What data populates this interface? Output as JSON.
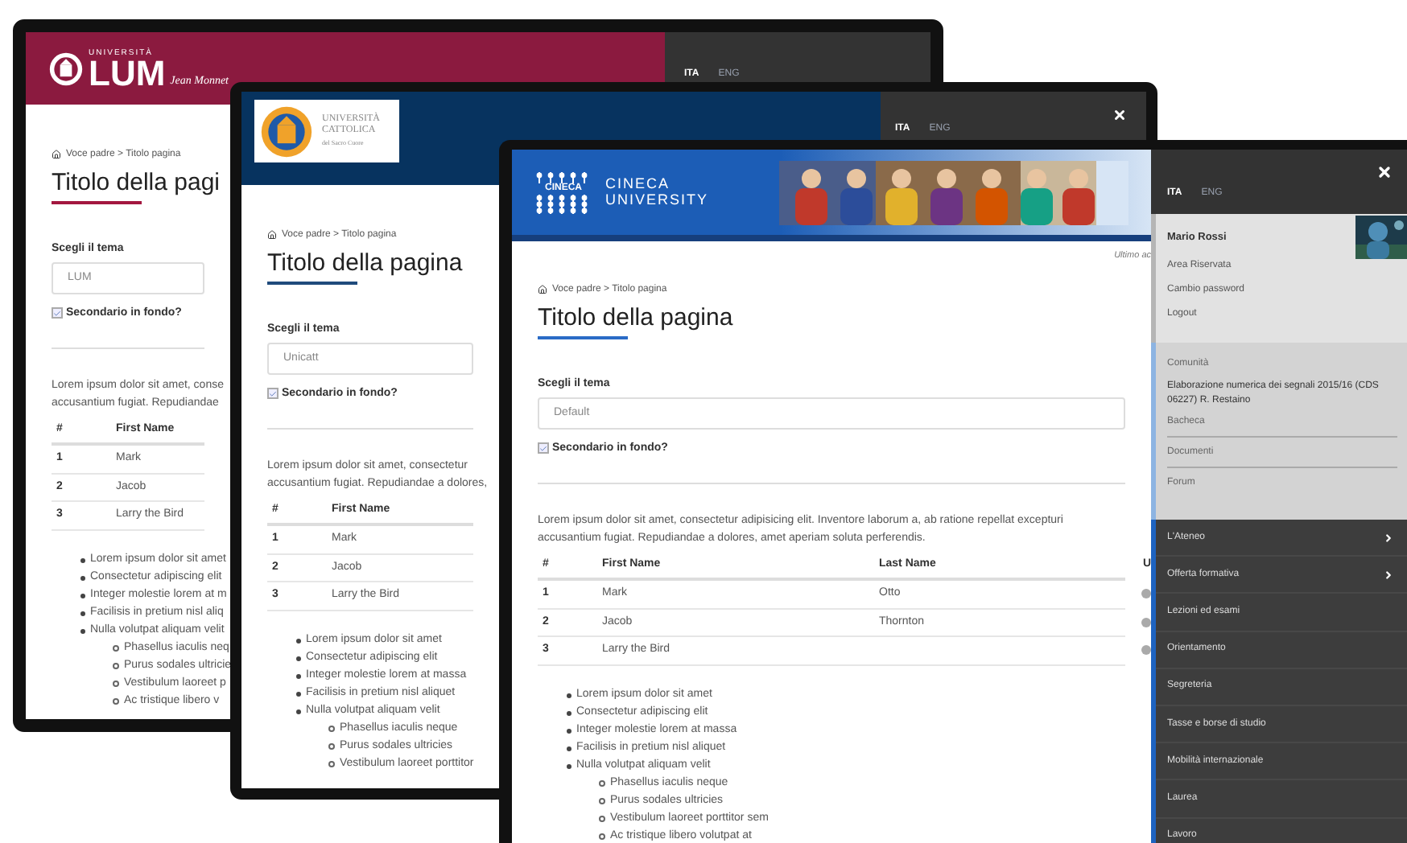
{
  "windows": [
    {
      "kind": "lum",
      "logo": {
        "overline": "UNIVERSITÀ",
        "name": "LUM",
        "signature": "Jean Monnet"
      },
      "languages": [
        {
          "label": "ITA",
          "selected": true
        },
        {
          "label": "ENG",
          "selected": false
        }
      ],
      "content": {
        "breadcrumb": "Voce padre > Titolo pagina",
        "title": "Titolo della pagi",
        "theme_label": "Scegli il tema",
        "theme_value": "LUM",
        "checkbox": {
          "label": "Secondario in fondo?",
          "checked": true
        },
        "paragraph": [
          "Lorem ipsum dolor sit amet, conse",
          "accusantium fugiat. Repudiandae"
        ],
        "table": {
          "columns": [
            "#",
            "First Name"
          ],
          "rows": [
            {
              "cells": [
                "1",
                "Mark"
              ]
            },
            {
              "cells": [
                "2",
                "Jacob"
              ]
            },
            {
              "cells": [
                "3",
                "Larry the Bird"
              ]
            }
          ]
        },
        "list": [
          {
            "text": "Lorem ipsum dolor sit amet"
          },
          {
            "text": "Consectetur adipiscing elit"
          },
          {
            "text": "Integer molestie lorem at m"
          },
          {
            "text": "Facilisis in pretium nisl aliq"
          },
          {
            "text": "Nulla volutpat aliquam velit",
            "children": [
              {
                "text": "Phasellus iaculis neq"
              },
              {
                "text": "Purus sodales ultricie"
              },
              {
                "text": "Vestibulum laoreet p"
              },
              {
                "text": "Ac tristique libero v"
              }
            ]
          }
        ]
      }
    },
    {
      "kind": "unicatt",
      "logo": {
        "lines": [
          "UNIVERSITÀ",
          "CATTOLICA",
          "del Sacro Cuore"
        ]
      },
      "languages": [
        {
          "label": "ITA",
          "selected": true
        },
        {
          "label": "ENG",
          "selected": false
        }
      ],
      "content": {
        "breadcrumb": "Voce padre > Titolo pagina",
        "title": "Titolo della pagina",
        "theme_label": "Scegli il tema",
        "theme_value": "Unicatt",
        "checkbox": {
          "label": "Secondario in fondo?",
          "checked": true
        },
        "paragraph": [
          "Lorem ipsum dolor sit amet, consectetur",
          "accusantium fugiat. Repudiandae a dolores,"
        ],
        "table": {
          "columns": [
            "#",
            "First Name"
          ],
          "rows": [
            {
              "cells": [
                "1",
                "Mark"
              ]
            },
            {
              "cells": [
                "2",
                "Jacob"
              ]
            },
            {
              "cells": [
                "3",
                "Larry the Bird"
              ]
            }
          ]
        },
        "list": [
          {
            "text": "Lorem ipsum dolor sit amet"
          },
          {
            "text": "Consectetur adipiscing elit"
          },
          {
            "text": "Integer molestie lorem at massa"
          },
          {
            "text": "Facilisis in pretium nisl aliquet"
          },
          {
            "text": "Nulla volutpat aliquam velit",
            "children": [
              {
                "text": "Phasellus iaculis neque"
              },
              {
                "text": "Purus sodales ultricies"
              },
              {
                "text": "Vestibulum laoreet porttitor"
              }
            ]
          }
        ]
      }
    },
    {
      "kind": "cineca",
      "logo": {
        "mark": "CINECA",
        "lines": [
          "CINECA",
          "UNIVERSITY"
        ]
      },
      "last_update": "Ultimo ac",
      "content": {
        "breadcrumb": "Voce padre > Titolo pagina",
        "title": "Titolo della pagina",
        "theme_label": "Scegli il tema",
        "theme_value": "Default",
        "checkbox": {
          "label": "Secondario in fondo?",
          "checked": true
        },
        "paragraph": [
          "Lorem ipsum dolor sit amet, consectetur adipisicing elit. Inventore laborum a, ab ratione repellat excepturi",
          "accusantium fugiat. Repudiandae a dolores, amet aperiam soluta perferendis."
        ],
        "table": {
          "columns": [
            "#",
            "First Name",
            "Last Name",
            "U"
          ],
          "rows": [
            {
              "cells": [
                "1",
                "Mark",
                "Otto"
              ]
            },
            {
              "cells": [
                "2",
                "Jacob",
                "Thornton"
              ]
            },
            {
              "cells": [
                "3",
                "Larry the Bird"
              ]
            }
          ]
        },
        "list": [
          {
            "text": "Lorem ipsum dolor sit amet"
          },
          {
            "text": "Consectetur adipiscing elit"
          },
          {
            "text": "Integer molestie lorem at massa"
          },
          {
            "text": "Facilisis in pretium nisl aliquet"
          },
          {
            "text": "Nulla volutpat aliquam velit",
            "children": [
              {
                "text": "Phasellus iaculis neque"
              },
              {
                "text": "Purus sodales ultricies"
              },
              {
                "text": "Vestibulum laoreet porttitor sem"
              },
              {
                "text": "Ac tristique libero volutpat at"
              }
            ]
          }
        ]
      },
      "sidebar": {
        "languages": [
          {
            "label": "ITA",
            "selected": true
          },
          {
            "label": "ENG",
            "selected": false
          }
        ],
        "user": {
          "name": "Mario Rossi",
          "links": [
            "Area Riservata",
            "Cambio password",
            "Logout"
          ]
        },
        "community": {
          "heading": "Comunità",
          "course": "Elaborazione numerica dei segnali 2015/16 (CDS 06227) R. Restaino",
          "links": [
            "Bacheca",
            "Documenti",
            "Forum"
          ]
        },
        "menu": [
          {
            "label": "L'Ateneo",
            "submenu": true
          },
          {
            "label": "Offerta formativa",
            "submenu": true
          },
          {
            "label": "Lezioni ed esami",
            "submenu": false
          },
          {
            "label": "Orientamento",
            "submenu": false
          },
          {
            "label": "Segreteria",
            "submenu": false
          },
          {
            "label": "Tasse e borse di studio",
            "submenu": false
          },
          {
            "label": "Mobilità internazionale",
            "submenu": false
          },
          {
            "label": "Laurea",
            "submenu": false
          },
          {
            "label": "Lavoro",
            "submenu": false
          }
        ]
      }
    }
  ]
}
